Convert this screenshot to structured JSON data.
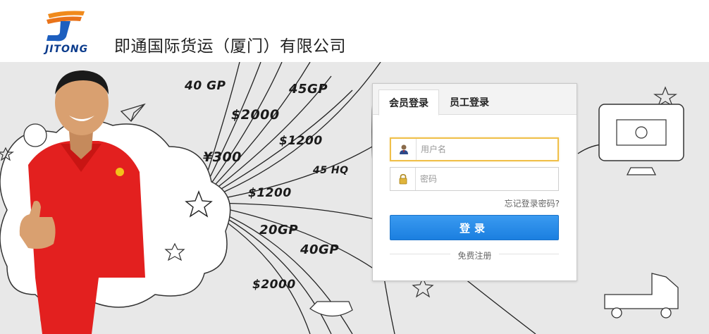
{
  "header": {
    "logo_text": "JITONG",
    "company_name": "即通国际货运（厦门）有限公司"
  },
  "hero": {
    "prices": [
      "40 GP",
      "45GP",
      "$2000",
      "$1200",
      "¥300",
      "45 HQ",
      "$1200",
      "20GP",
      "40GP",
      "$2000"
    ]
  },
  "login": {
    "tabs": [
      {
        "label": "会员登录",
        "active": true
      },
      {
        "label": "员工登录",
        "active": false
      }
    ],
    "username_placeholder": "用户名",
    "password_placeholder": "密码",
    "forgot_label": "忘记登录密码?",
    "submit_label": "登录",
    "register_label": "免费注册"
  },
  "colors": {
    "button": "#1b7fe0",
    "focus_border": "#f0c04a",
    "shirt": "#e3201f"
  },
  "icons": {
    "username": "user-icon",
    "password": "lock-icon"
  }
}
